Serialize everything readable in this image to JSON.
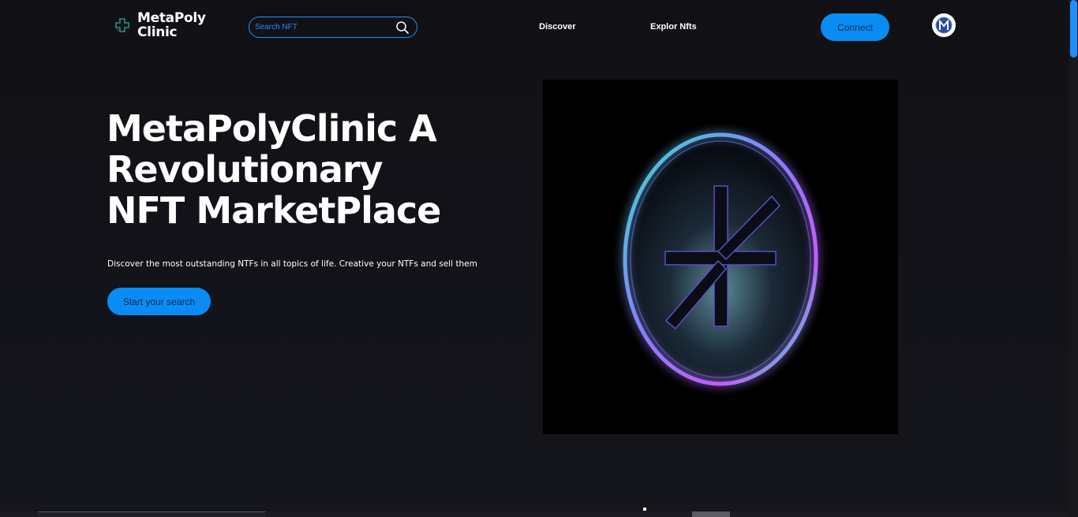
{
  "header": {
    "logo": {
      "line1": "MetaPoly",
      "line2": "Clinic",
      "icon": "medical-cross-icon"
    },
    "search": {
      "placeholder": "Search NFT",
      "icon": "search-icon"
    },
    "nav": {
      "discover": "Discover",
      "explore": "Explor Nfts"
    },
    "connect_label": "Connect",
    "avatar_icon": "profile-avatar-icon"
  },
  "hero": {
    "title_line1": "MetaPolyClinic A",
    "title_line2": "Revolutionary",
    "title_line3": "NFT MarketPlace",
    "subtitle": "Discover the most outstanding NTFs in all topics of life. Creative your NTFs and sell them",
    "cta_label": "Start your search",
    "image_icon": "glowing-coin-logo-icon"
  },
  "colors": {
    "background": "#121218",
    "accent": "#0a8cf5",
    "text": "#ffffff"
  }
}
